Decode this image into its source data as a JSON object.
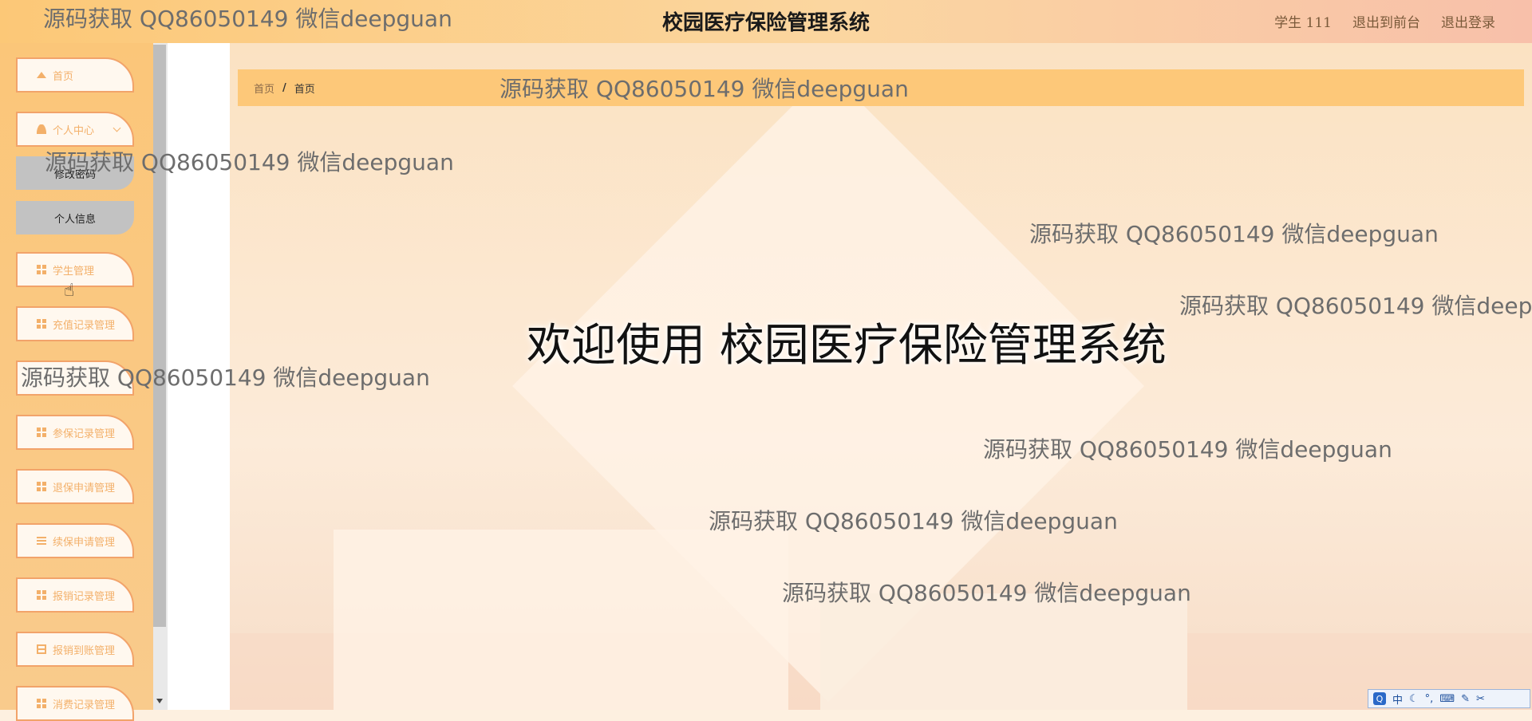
{
  "header": {
    "title": "校园医疗保险管理系统",
    "user_label": "学生 111",
    "front_link": "退出到前台",
    "logout_link": "退出登录"
  },
  "sidebar": {
    "items": [
      {
        "label": "首页",
        "icon": "home-icon"
      },
      {
        "label": "个人中心",
        "icon": "user-icon"
      },
      {
        "label": "学生管理",
        "icon": "grid-icon"
      },
      {
        "label": "充值记录管理",
        "icon": "grid-icon"
      },
      {
        "label": "",
        "icon": ""
      },
      {
        "label": "参保记录管理",
        "icon": "grid-icon"
      },
      {
        "label": "退保申请管理",
        "icon": "grid-icon"
      },
      {
        "label": "续保申请管理",
        "icon": "list-icon"
      },
      {
        "label": "报销记录管理",
        "icon": "grid-icon"
      },
      {
        "label": "报销到账管理",
        "icon": "table-icon"
      },
      {
        "label": "消费记录管理",
        "icon": "grid-icon"
      }
    ],
    "sub_items": [
      "修改密码",
      "个人信息"
    ]
  },
  "breadcrumb": {
    "home": "首页",
    "separator": "/",
    "current": "首页"
  },
  "welcome": {
    "text": "欢迎使用  校园医疗保险管理系统"
  },
  "watermark": "源码获取 QQ86050149 微信deepguan",
  "ime": {
    "logo": "Q",
    "mode": "中",
    "moon": "☾",
    "dot": "°,",
    "kbd": "⌨",
    "pen": "✎",
    "tool": "✂"
  }
}
